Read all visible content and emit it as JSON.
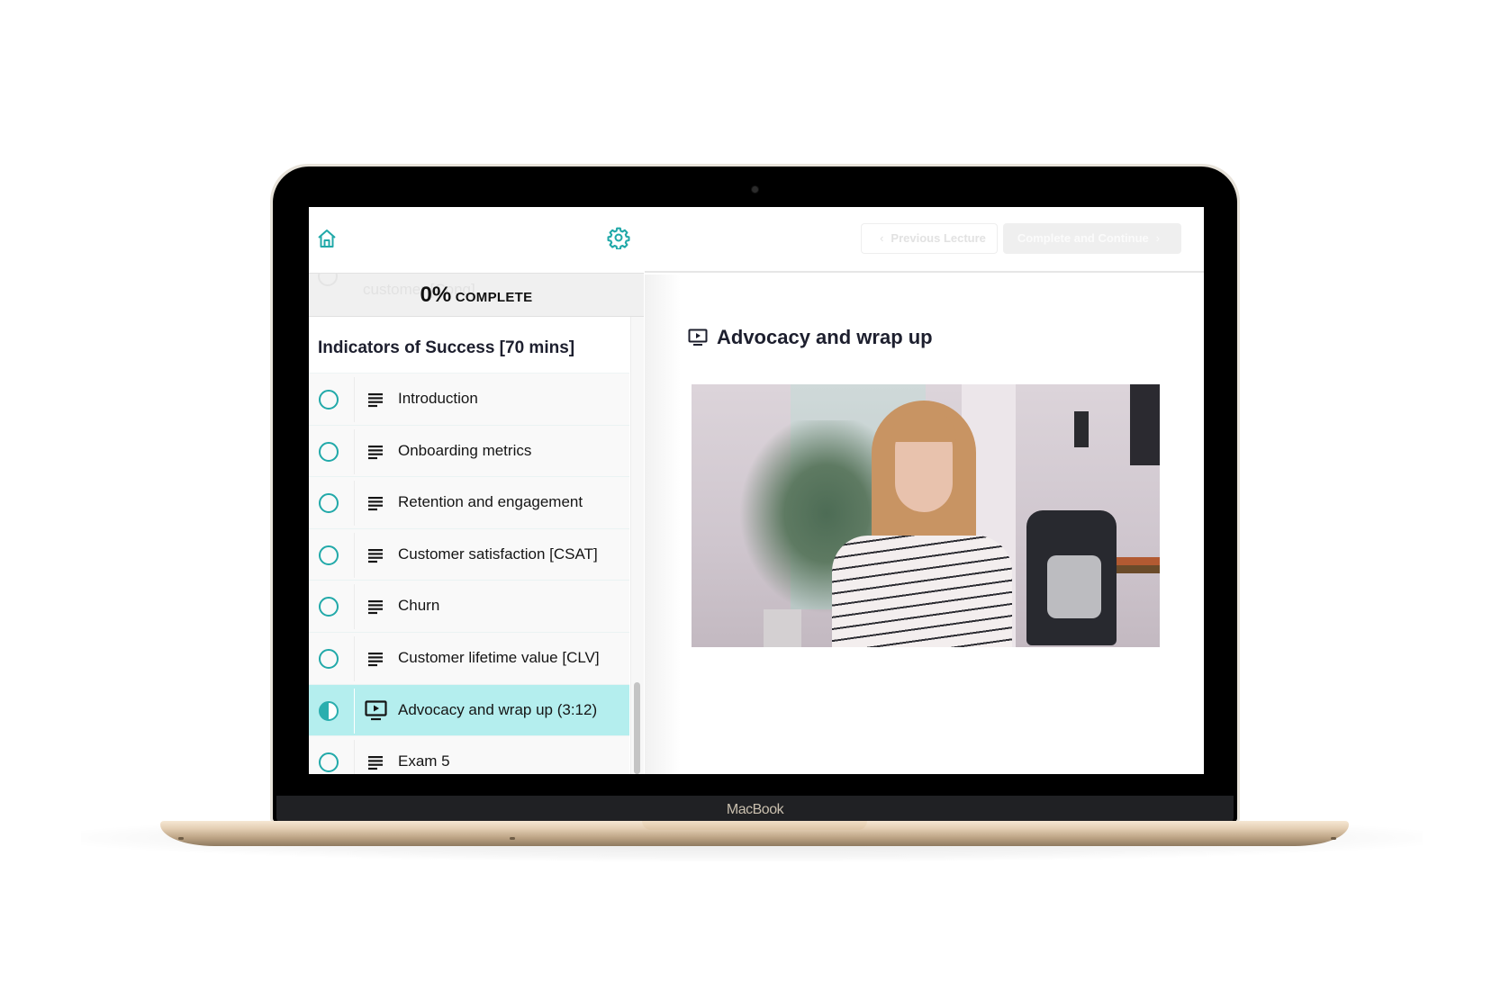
{
  "device": {
    "label": "MacBook"
  },
  "sidebar": {
    "home_icon": "home-icon",
    "settings_icon": "gear-icon",
    "progress": {
      "percent_value": 0,
      "percent_text": "0%",
      "label": "COMPLETE"
    },
    "ghost_item_text": "customer [Cong]",
    "section": {
      "title": "Indicators of Success [70 mins]",
      "lectures": [
        {
          "label": "Introduction",
          "type": "text",
          "status": "not-started"
        },
        {
          "label": "Onboarding metrics",
          "type": "text",
          "status": "not-started"
        },
        {
          "label": "Retention and engagement",
          "type": "text",
          "status": "not-started"
        },
        {
          "label": "Customer satisfaction [CSAT]",
          "type": "text",
          "status": "not-started"
        },
        {
          "label": "Churn",
          "type": "text",
          "status": "not-started"
        },
        {
          "label": "Customer lifetime value [CLV]",
          "type": "text",
          "status": "not-started"
        },
        {
          "label": "Advocacy and wrap up (3:12)",
          "type": "video",
          "status": "in-progress",
          "active": true
        },
        {
          "label": "Exam 5",
          "type": "text",
          "status": "not-started"
        }
      ]
    }
  },
  "main": {
    "buttons": {
      "previous": "Previous Lecture",
      "complete_continue": "Complete and Continue"
    },
    "lecture_title": "Advocacy and wrap up",
    "video": {
      "description": "Presenter video thumbnail"
    }
  },
  "colors": {
    "accent": "#21a9a9",
    "active_row": "#b4eeee",
    "title_text": "#1d1f2e"
  }
}
